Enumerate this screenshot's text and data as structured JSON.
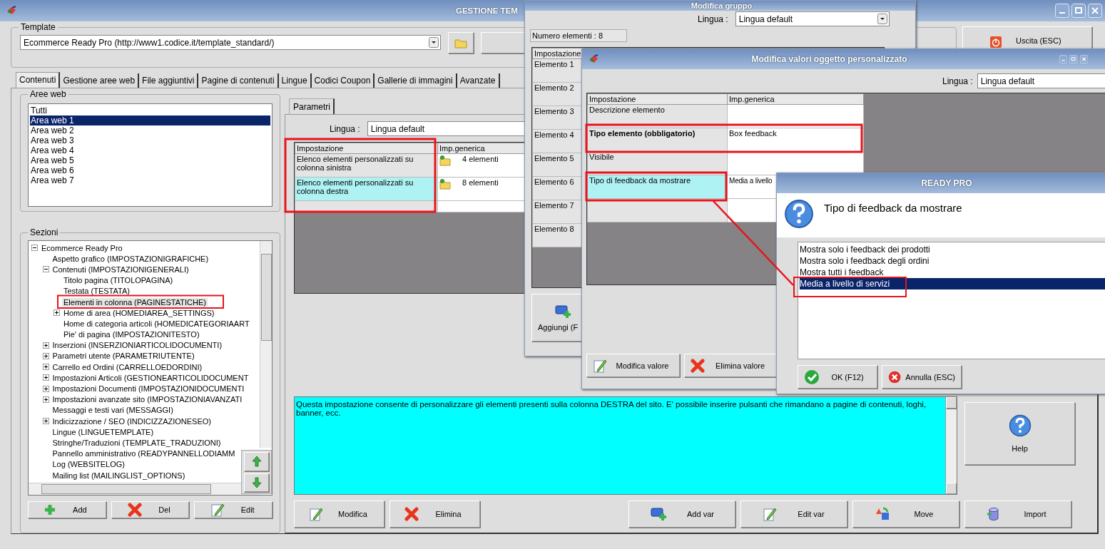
{
  "main_window": {
    "title": "GESTIONE TEM",
    "template": {
      "label": "Template",
      "value": "Ecommerce Ready Pro (http://www1.codice.it/template_standard/)"
    },
    "exit_button": "Uscita (ESC)",
    "tabs": [
      {
        "label": "Contenuti",
        "selected": true
      },
      {
        "label": "Gestione aree web",
        "selected": false
      },
      {
        "label": "File aggiuntivi",
        "selected": false
      },
      {
        "label": "Pagine di contenuti",
        "selected": false
      },
      {
        "label": "Lingue",
        "selected": false
      },
      {
        "label": "Codici Coupon",
        "selected": false
      },
      {
        "label": "Gallerie di immagini",
        "selected": false
      },
      {
        "label": "Avanzate",
        "selected": false
      }
    ],
    "aree_web": {
      "label": "Aree web",
      "items": [
        {
          "label": "Tutti",
          "selected": false
        },
        {
          "label": "Area web 1",
          "selected": true
        },
        {
          "label": "Area web 2",
          "selected": false
        },
        {
          "label": "Area web 3",
          "selected": false
        },
        {
          "label": "Area web 4",
          "selected": false
        },
        {
          "label": "Area web 5",
          "selected": false
        },
        {
          "label": "Area web 6",
          "selected": false
        },
        {
          "label": "Area web 7",
          "selected": false
        }
      ]
    },
    "sezioni": {
      "label": "Sezioni",
      "tree": [
        {
          "label": "Ecommerce Ready Pro",
          "expanded": true,
          "selected": false,
          "children": [
            {
              "label": "Aspetto grafico (IMPOSTAZIONIGRAFICHE)",
              "selected": false
            },
            {
              "label": "Contenuti (IMPOSTAZIONIGENERALI)",
              "expanded": true,
              "selected": false,
              "children": [
                {
                  "label": "Titolo pagina (TITOLOPAGINA)",
                  "selected": false
                },
                {
                  "label": "Testata (TESTATA)",
                  "selected": false
                },
                {
                  "label": "Elementi in colonna (PAGINESTATICHE)",
                  "selected": true
                },
                {
                  "label": "Home di area (HOMEDIAREA_SETTINGS)",
                  "expanded": false,
                  "selected": false
                },
                {
                  "label": "Home di categoria articoli (HOMEDICATEGORIAART",
                  "selected": false
                },
                {
                  "label": "Pie' di pagina (IMPOSTAZIONITESTO)",
                  "selected": false
                }
              ]
            },
            {
              "label": "Inserzioni (INSERZIONIARTICOLIDOCUMENTI)",
              "expanded": false,
              "selected": false
            },
            {
              "label": "Parametri utente (PARAMETRIUTENTE)",
              "expanded": false,
              "selected": false
            },
            {
              "label": "Carrello ed Ordini (CARRELLOEDORDINI)",
              "expanded": false,
              "selected": false
            },
            {
              "label": "Impostazioni Articoli (GESTIONEARTICOLIDOCUMENT",
              "expanded": false,
              "selected": false
            },
            {
              "label": "Impostazioni Documenti (IMPOSTAZIONIDOCUMENTI",
              "expanded": false,
              "selected": false
            },
            {
              "label": "Impostazioni avanzate sito (IMPOSTAZIONIAVANZATI",
              "expanded": false,
              "selected": false
            },
            {
              "label": "Messaggi e testi vari (MESSAGGI)",
              "selected": false
            },
            {
              "label": "Indicizzazione / SEO (INDICIZZAZIONESEO)",
              "expanded": false,
              "selected": false
            },
            {
              "label": "Lingue (LINGUETEMPLATE)",
              "selected": false
            },
            {
              "label": "Stringhe/Traduzioni (TEMPLATE_TRADUZIONI)",
              "selected": false
            },
            {
              "label": "Pannello amministrativo (READYPANNELLODIAMM",
              "selected": false
            },
            {
              "label": "Log (WEBSITELOG)",
              "selected": false
            },
            {
              "label": "Mailing list (MAILINGLIST_OPTIONS)",
              "selected": false
            }
          ]
        }
      ],
      "buttons": [
        "Add",
        "Del",
        "Edit"
      ]
    },
    "parametri": {
      "tab": "Parametri",
      "lingua_label": "Lingua :",
      "lingua_value": "Lingua default",
      "columns": [
        "Impostazione",
        "Imp.generica"
      ],
      "rows": [
        {
          "setting": "Elenco elementi personalizzati su colonna sinistra",
          "value": "4 elementi",
          "selected": false
        },
        {
          "setting": "Elenco elementi personalizzati su colonna destra",
          "value": "8 elementi",
          "selected": true
        }
      ],
      "description": "Questa impostazione consente di personalizzare gli elementi presenti sulla colonna DESTRA del sito. E' possibile inserire pulsanti che rimandano a pagine di contenuti, loghi, banner, ecc.",
      "help_button": "Help",
      "buttons": [
        {
          "kind": "edit",
          "label": "Modifica"
        },
        {
          "kind": "delete",
          "label": "Elimina"
        },
        {
          "kind": "add",
          "label": "Add var"
        },
        {
          "kind": "edit",
          "label": "Edit var"
        },
        {
          "kind": "move",
          "label": "Move"
        },
        {
          "kind": "import",
          "label": "Import"
        }
      ]
    }
  },
  "group_window": {
    "title": "Modifica gruppo",
    "lingua_label": "Lingua :",
    "lingua_value": "Lingua default",
    "count": "Numero elementi : 8",
    "column": "Impostazione",
    "rows": [
      "Elemento 1",
      "Elemento 2",
      "Elemento 3",
      "Elemento 4",
      "Elemento 5",
      "Elemento 6",
      "Elemento 7",
      "Elemento 8"
    ],
    "add_button": "Aggiungi (F"
  },
  "values_window": {
    "title": "Modifica valori oggetto personalizzato",
    "lingua_label": "Lingua :",
    "lingua_value": "Lingua default",
    "columns": [
      "Impostazione",
      "Imp.generica"
    ],
    "rows": [
      {
        "setting": "Descrizione elemento",
        "value": "",
        "bold": false,
        "selected": false
      },
      {
        "setting": "Tipo elemento (obbligatorio)",
        "value": "Box feedback",
        "bold": true,
        "selected": false
      },
      {
        "setting": "Visibile",
        "value": "",
        "bold": false,
        "selected": false
      },
      {
        "setting": "Tipo di feedback da mostrare",
        "value": "Media a livello",
        "bold": false,
        "selected": true
      }
    ],
    "buttons": [
      {
        "kind": "edit",
        "label": "Modifica valore"
      },
      {
        "kind": "delete",
        "label": "Elimina valore"
      }
    ]
  },
  "dialog": {
    "title": "READY PRO",
    "question": "Tipo di feedback da mostrare",
    "options": [
      {
        "label": "Mostra solo i feedback dei prodotti",
        "selected": false
      },
      {
        "label": "Mostra solo i feedback degli ordini",
        "selected": false
      },
      {
        "label": "Mostra tutti i feedback",
        "selected": false
      },
      {
        "label": "Media a livello di servizi",
        "selected": true
      }
    ],
    "buttons": [
      {
        "kind": "ok",
        "label": "OK (F12)"
      },
      {
        "kind": "cancel",
        "label": "Annulla (ESC)"
      }
    ]
  }
}
